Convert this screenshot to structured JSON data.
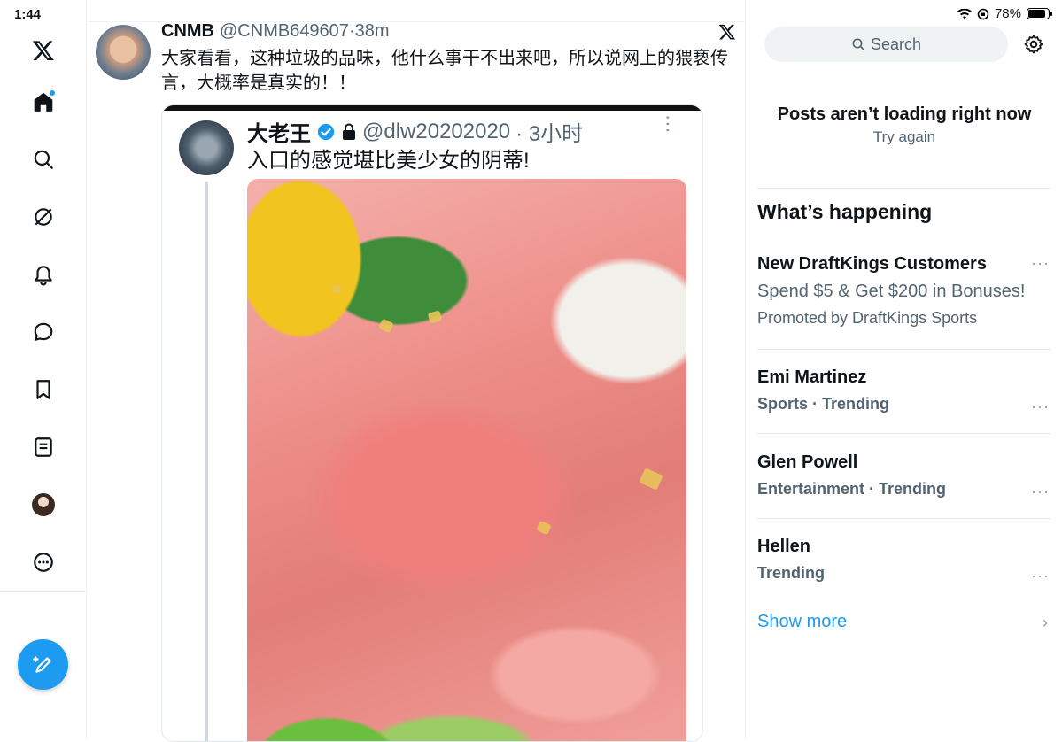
{
  "status": {
    "time": "1:44",
    "battery": "78%"
  },
  "tweet": {
    "name": "CNMB",
    "handle": "@CNMB649607",
    "time": "·38m",
    "text": "大家看看，这种垃圾的品味，他什么事干不出来吧，所以说网上的猥亵传言，大概率是真实的！！",
    "embed": {
      "name": "大老王",
      "handle": "@dlw20202020",
      "time": "· 3小时",
      "text": "入口的感觉堪比美少女的阴蒂!"
    }
  },
  "search": {
    "placeholder": "Search"
  },
  "loading": {
    "title": "Posts aren’t loading right now",
    "retry": "Try again"
  },
  "happening": {
    "title": "What’s happening",
    "promo": {
      "title": "New DraftKings Customers",
      "line": "Spend $5 & Get $200 in Bonuses!",
      "by": "Promoted by DraftKings Sports"
    },
    "trends": [
      {
        "title": "Emi Martinez",
        "meta": "Sports · Trending"
      },
      {
        "title": "Glen Powell",
        "meta": "Entertainment · Trending"
      },
      {
        "title": "Hellen",
        "meta": "Trending"
      }
    ],
    "show_more": "Show more"
  },
  "colors": {
    "accent": "#1d9bf0",
    "secondary_text": "#536471"
  },
  "icons": {
    "nav": [
      "x-logo-icon",
      "home-icon",
      "search-icon",
      "communities-icon",
      "notifications-icon",
      "messages-icon",
      "bookmarks-icon",
      "lists-icon",
      "profile-avatar",
      "more-icon"
    ]
  }
}
